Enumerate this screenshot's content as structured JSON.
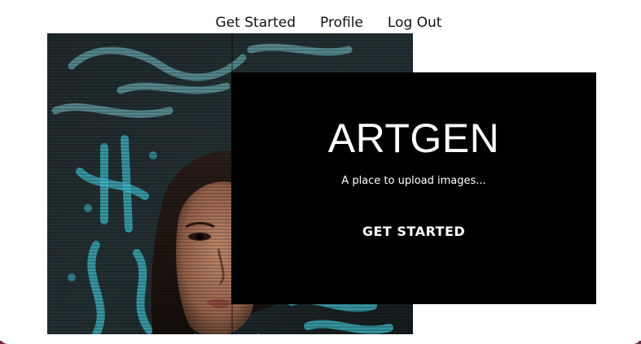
{
  "nav": {
    "get_started": "Get Started",
    "profile": "Profile",
    "log_out": "Log Out"
  },
  "hero": {
    "title": "ARTGEN",
    "subtitle": "A place to upload images...",
    "cta_label": "GET STARTED"
  },
  "colors": {
    "card_background": "#000000",
    "card_text": "#ffffff",
    "nav_text": "#111111",
    "page_background": "#ffffff",
    "graffiti_accent": "#3fb9c8"
  },
  "image": {
    "semantic": "portrait-photo-woman-graffiti-background"
  }
}
